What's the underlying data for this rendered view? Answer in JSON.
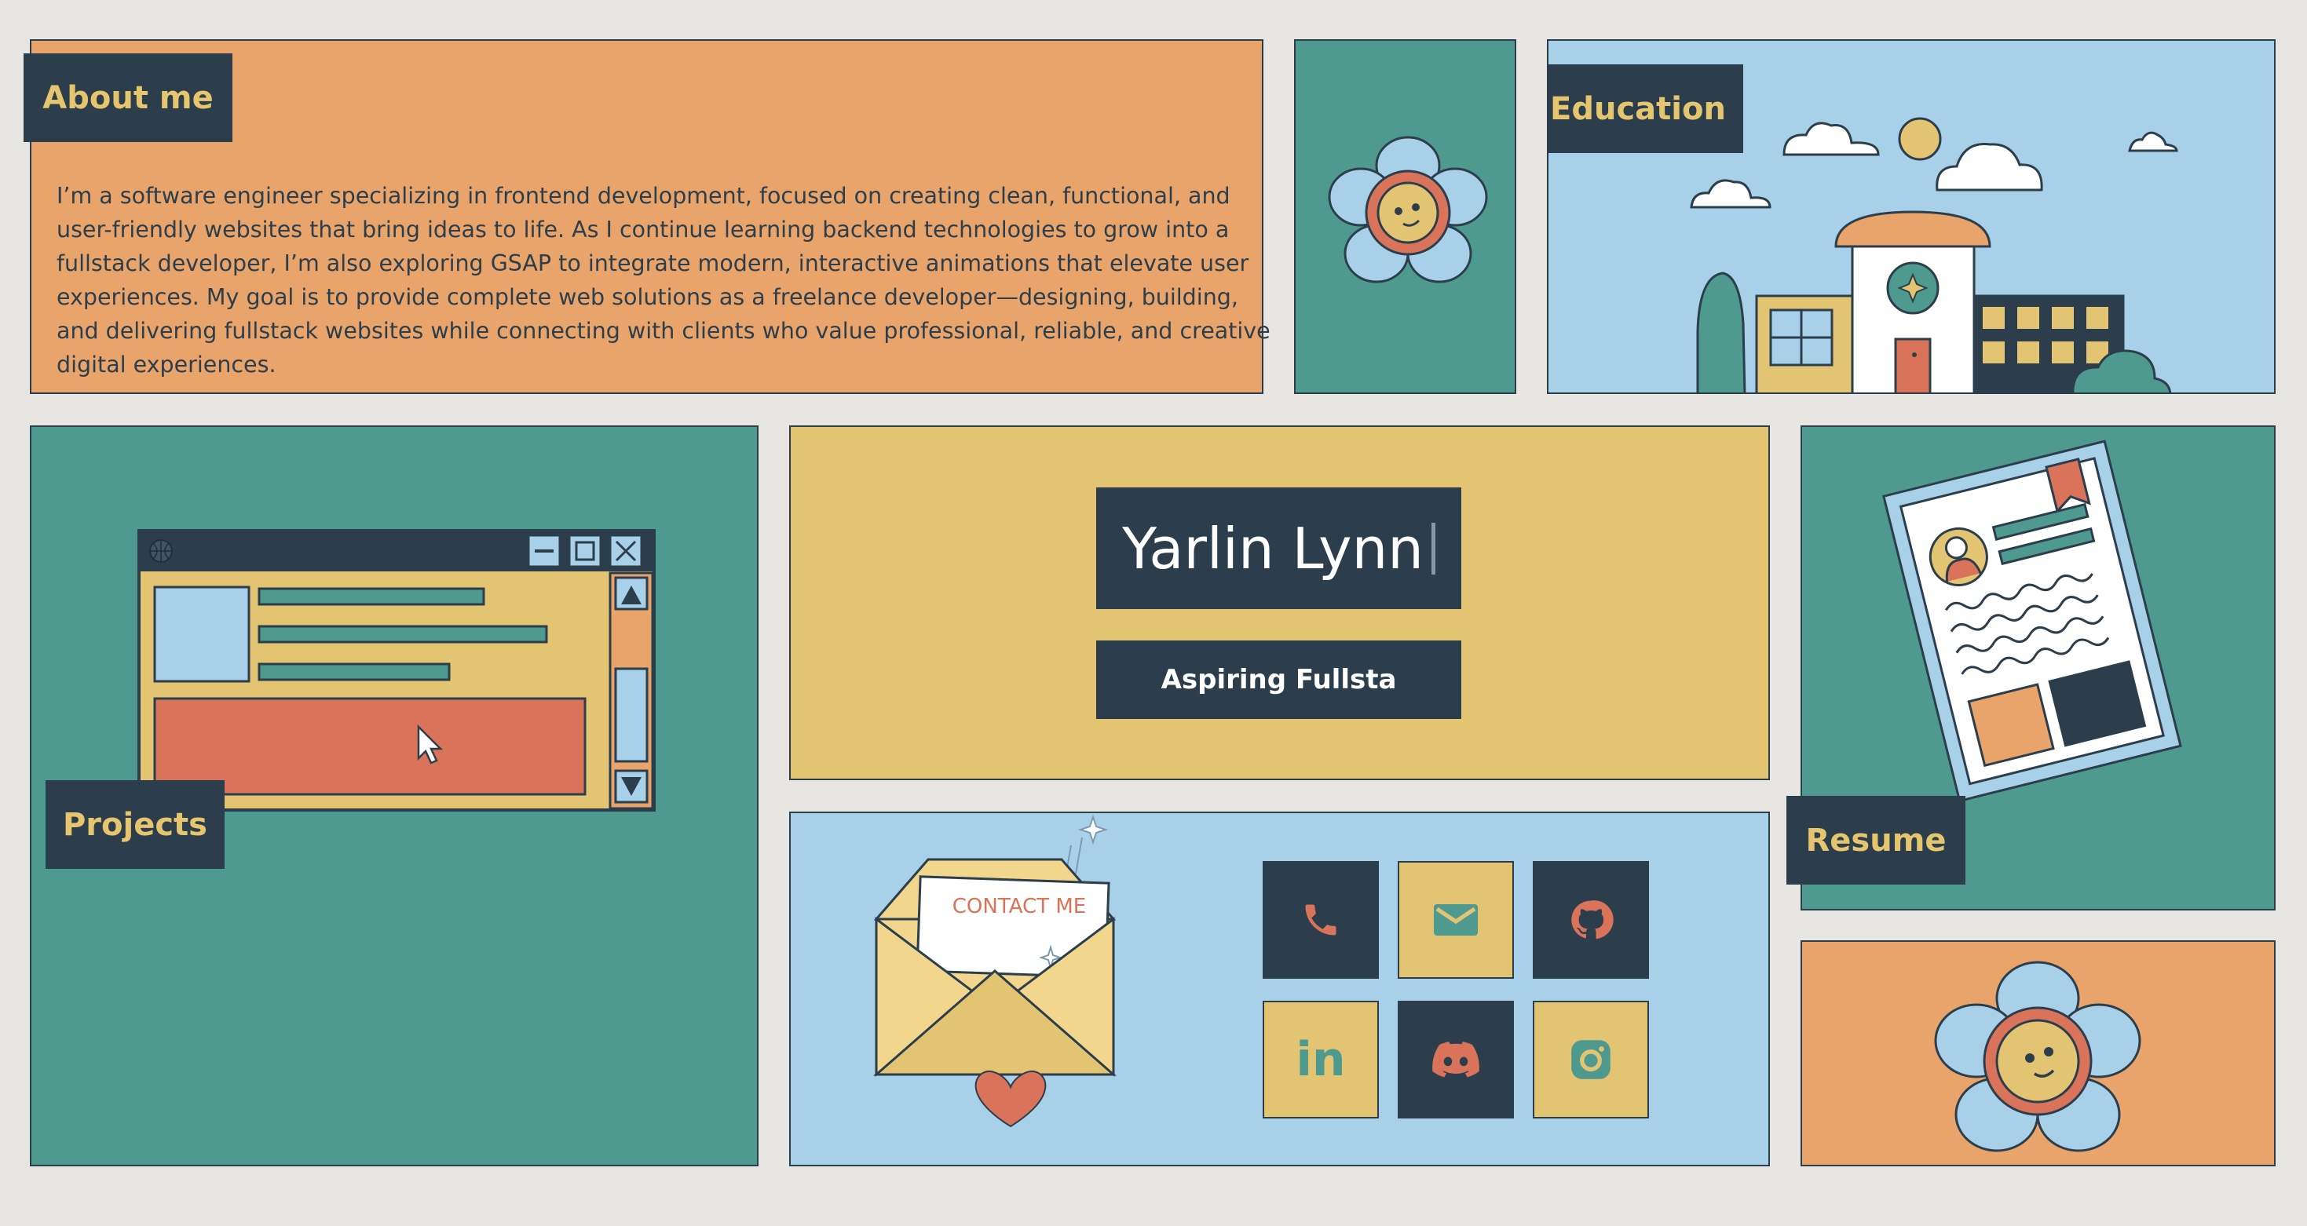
{
  "about": {
    "title": "About me",
    "body": "I’m a software engineer specializing in frontend development, focused on creating clean, functional, and user-friendly websites that bring ideas to life. As I continue learning backend technologies to grow into a fullstack developer, I’m also exploring GSAP to integrate modern, interactive animations that elevate user experiences. My goal is to provide complete web solutions as a freelance developer—designing, building, and delivering fullstack websites while connecting with clients who value professional, reliable, and creative digital experiences."
  },
  "education": {
    "title": "Education"
  },
  "projects": {
    "title": "Projects"
  },
  "hero": {
    "name": "Yarlin Lynn",
    "subtitle": "Aspiring Fullsta"
  },
  "resume": {
    "title": "Resume"
  },
  "contact": {
    "envelope_label": "CONTACT ME",
    "socials": [
      {
        "icon": "phone-icon"
      },
      {
        "icon": "mail-icon"
      },
      {
        "icon": "github-icon"
      },
      {
        "icon": "linkedin-icon",
        "text": "in"
      },
      {
        "icon": "discord-icon"
      },
      {
        "icon": "instagram-icon"
      }
    ]
  },
  "colors": {
    "navy": "#2c3e4c",
    "orange": "#e8a46a",
    "teal": "#4f9a8e",
    "sky": "#a8d0e8",
    "mustard": "#e3c472",
    "coral": "#d9745a",
    "background": "#e8e6e3"
  }
}
